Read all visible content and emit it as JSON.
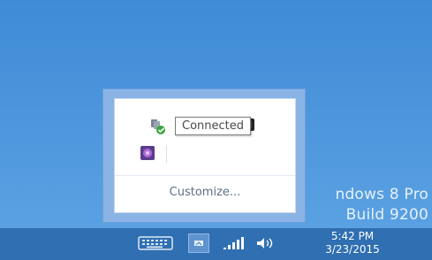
{
  "desktop": {
    "watermark_line1": "ndows 8 Pro",
    "watermark_line2": "Build 9200"
  },
  "tray_overflow": {
    "tooltip": "Connected",
    "customize_label": "Customize...",
    "icons": [
      {
        "name": "network-connected-icon"
      },
      {
        "name": "faded-app-icon"
      },
      {
        "name": "dark-app-icon"
      },
      {
        "name": "purple-app-icon"
      }
    ]
  },
  "taskbar": {
    "time": "5:42 PM",
    "date": "3/23/2015",
    "icons": [
      "keyboard-icon",
      "show-hidden-icons-icon",
      "signal-icon",
      "volume-icon"
    ]
  },
  "colors": {
    "desktop_blue": "#4a93d8",
    "taskbar_blue": "#2f6fb2",
    "overflow_frame": "#8ab4e6"
  }
}
